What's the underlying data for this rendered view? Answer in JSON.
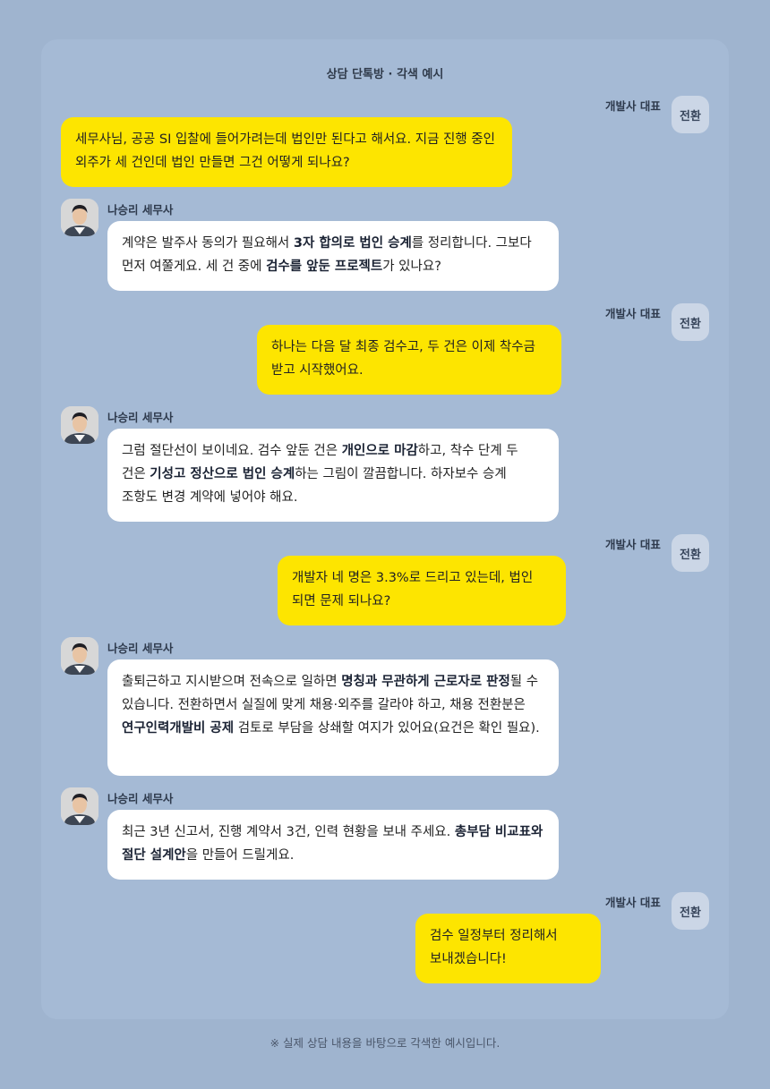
{
  "chat": {
    "title": "상담 단톡방 · 각색 예시",
    "user_name": "개발사 대표",
    "user_badge": "전환",
    "advisor_name": "나승리 세무사",
    "messages": [
      {
        "from": "user",
        "segments": [
          {
            "t": "세무사님, 공공 SI 입찰에 들어가려는데 법인만 된다고 해서요. 지금 진행 중인 외주가 세 건인데 법인 만들면 그건 어떻게 되나요?"
          }
        ]
      },
      {
        "from": "advisor",
        "segments": [
          {
            "t": "계약은 발주사 동의가 필요해서 "
          },
          {
            "t": "3자 합의로 법인 승계",
            "b": true
          },
          {
            "t": "를 정리합니다. 그보다 먼저 여쭐게요. 세 건 중에 "
          },
          {
            "t": "검수를 앞둔 프로젝트",
            "b": true
          },
          {
            "t": "가 있나요?"
          }
        ]
      },
      {
        "from": "user",
        "segments": [
          {
            "t": "하나는 다음 달 최종 검수고, 두 건은 이제 착수금 받고 시작했어요."
          }
        ]
      },
      {
        "from": "advisor",
        "segments": [
          {
            "t": "그럼 절단선이 보이네요. 검수 앞둔 건은 "
          },
          {
            "t": "개인으로 마감",
            "b": true
          },
          {
            "t": "하고, 착수 단계 두 건은 "
          },
          {
            "t": "기성고 정산으로 법인 승계",
            "b": true
          },
          {
            "t": "하는 그림이 깔끔합니다. 하자보수 승계 조항도 변경 계약에 넣어야 해요."
          }
        ]
      },
      {
        "from": "user",
        "segments": [
          {
            "t": "개발자 네 명은 3.3%로 드리고 있는데, 법인 되면 문제 되나요?"
          }
        ]
      },
      {
        "from": "advisor",
        "segments": [
          {
            "t": "출퇴근하고 지시받으며 전속으로 일하면 "
          },
          {
            "t": "명칭과 무관하게 근로자로 판정",
            "b": true
          },
          {
            "t": "될 수 있습니다. 전환하면서 실질에 맞게 채용·외주를 갈라야 하고, 채용 전환분은 "
          },
          {
            "t": "연구인력개발비 공제",
            "b": true
          },
          {
            "t": " 검토로 부담을 상쇄할 여지가 있어요(요건은 확인 필요)."
          }
        ]
      },
      {
        "from": "advisor",
        "segments": [
          {
            "t": "최근 3년 신고서, 진행 계약서 3건, 인력 현황을 보내 주세요. "
          },
          {
            "t": "총부담 비교표와 절단 설계안",
            "b": true
          },
          {
            "t": "을 만들어 드릴게요."
          }
        ]
      },
      {
        "from": "user",
        "segments": [
          {
            "t": "검수 일정부터 정리해서 보내겠습니다!"
          }
        ]
      }
    ]
  },
  "footer": {
    "note": "※ 실제 상담 내용을 바탕으로 각색한 예시입니다."
  },
  "colors": {
    "background": "#9fb4cf",
    "panel": "#a5bad5",
    "user_bubble": "#fde500",
    "advisor_bubble": "#ffffff",
    "badge": "#cbd6e6"
  },
  "icons": {
    "avatar": "advisor-portrait-icon"
  }
}
